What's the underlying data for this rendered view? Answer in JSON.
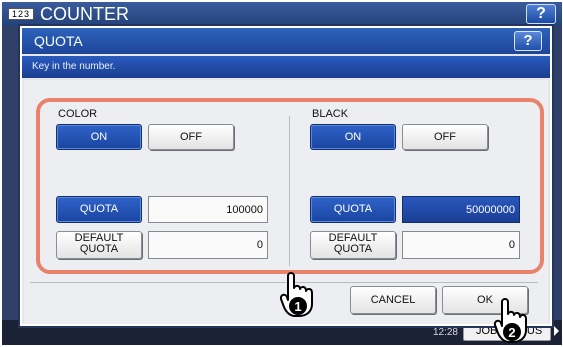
{
  "background_screen": {
    "counter_icon": "123",
    "title": "COUNTER",
    "help_label": "?",
    "time_lines": [
      "12:28"
    ],
    "job_button_label": "JOB STATUS",
    "colors": {
      "titlebar": "#23427c",
      "body": "#2f4168"
    }
  },
  "dialog": {
    "title": "QUOTA",
    "help_label": "?",
    "message": "Key in the number.",
    "color_section": {
      "label": "COLOR",
      "on_label": "ON",
      "off_label": "OFF",
      "quota_label": "QUOTA",
      "quota_value": "100000",
      "default_quota_label_line1": "DEFAULT",
      "default_quota_label_line2": "QUOTA",
      "default_quota_value": "0",
      "selected": "ON"
    },
    "black_section": {
      "label": "BLACK",
      "on_label": "ON",
      "off_label": "OFF",
      "quota_label": "QUOTA",
      "quota_value": "50000000",
      "default_quota_label_line1": "DEFAULT",
      "default_quota_label_line2": "QUOTA",
      "default_quota_value": "0",
      "selected": "ON",
      "active_field": "quota"
    },
    "cancel_label": "CANCEL",
    "ok_label": "OK"
  },
  "annotations": {
    "step1": "1",
    "step2": "2",
    "highlight_color": "#e8826b"
  },
  "colors": {
    "accent_blue": "#1c4599",
    "button_on": "#2f63c9",
    "dialog_bg": "#e4e6ea"
  }
}
